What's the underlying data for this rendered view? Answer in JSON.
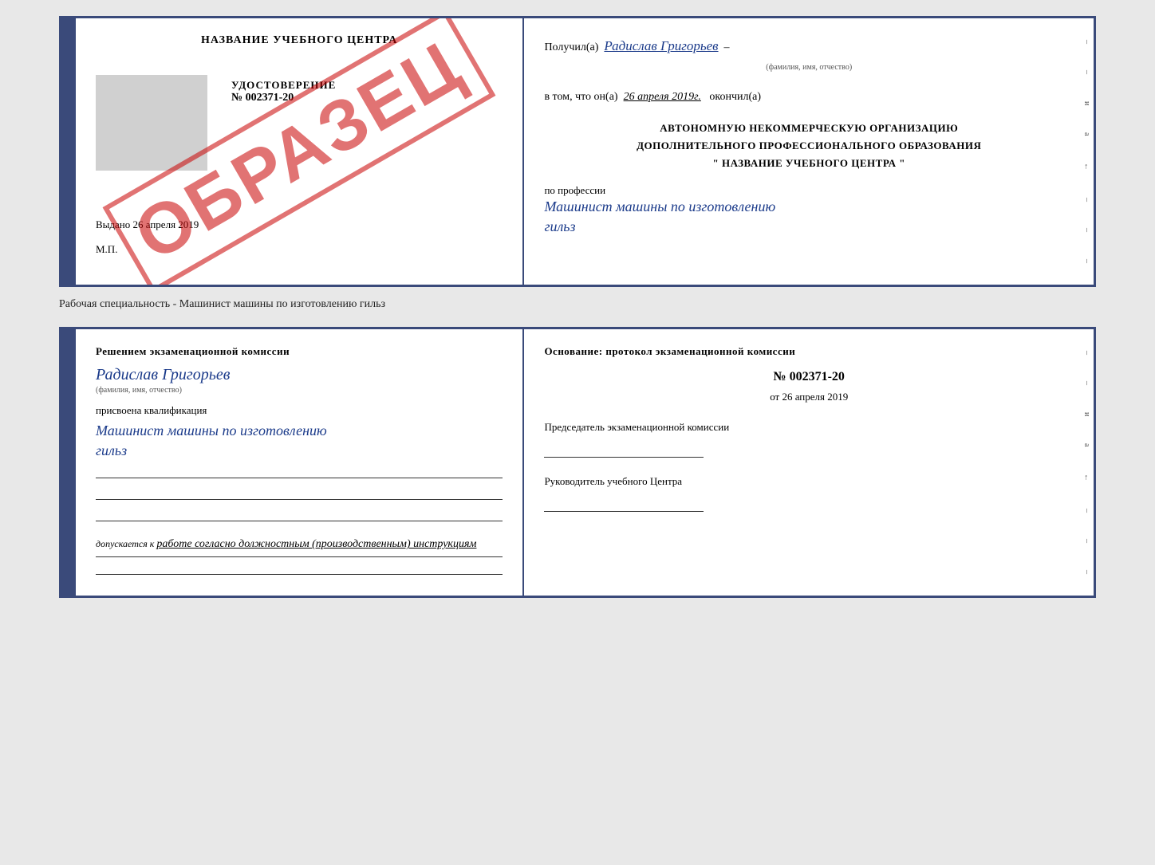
{
  "top_book": {
    "left_page": {
      "school_name": "НАЗВАНИЕ УЧЕБНОГО ЦЕНТРА",
      "certificate_title": "УДОСТОВЕРЕНИЕ",
      "certificate_number": "№ 002371-20",
      "issued_label": "Выдано",
      "issued_date": "26 апреля 2019",
      "mp_label": "М.П.",
      "watermark": "ОБРАЗЕЦ"
    },
    "right_page": {
      "received_label": "Получил(а)",
      "received_name": "Радислав Григорьев",
      "fio_hint": "(фамилия, имя, отчество)",
      "date_prefix": "в том, что он(а)",
      "date_value": "26 апреля 2019г.",
      "date_suffix": "окончил(а)",
      "org_line1": "АВТОНОМНУЮ НЕКОММЕРЧЕСКУЮ ОРГАНИЗАЦИЮ",
      "org_line2": "ДОПОЛНИТЕЛЬНОГО ПРОФЕССИОНАЛЬНОГО ОБРАЗОВАНИЯ",
      "org_line3": "\" НАЗВАНИЕ УЧЕБНОГО ЦЕНТРА \"",
      "profession_label": "по профессии",
      "profession_name": "Машинист машины по изготовлению",
      "profession_name2": "гильз"
    }
  },
  "specialty_line": "Рабочая специальность - Машинист машины по изготовлению гильз",
  "bottom_book": {
    "left_page": {
      "decision_header": "Решением  экзаменационной  комиссии",
      "person_name": "Радислав Григорьев",
      "fio_hint": "(фамилия, имя, отчество)",
      "qualification_label": "присвоена квалификация",
      "qualification_name": "Машинист  машины  по  изготовлению",
      "qualification_name2": "гильз",
      "admission_text": "допускается к  работе согласно должностным (производственным) инструкциям"
    },
    "right_page": {
      "basis_header": "Основание: протокол экзаменационной  комиссии",
      "protocol_number": "№  002371-20",
      "protocol_date_prefix": "от",
      "protocol_date": "26 апреля 2019",
      "chairman_label": "Председатель экзаменационной комиссии",
      "director_label": "Руководитель учебного Центра"
    }
  }
}
